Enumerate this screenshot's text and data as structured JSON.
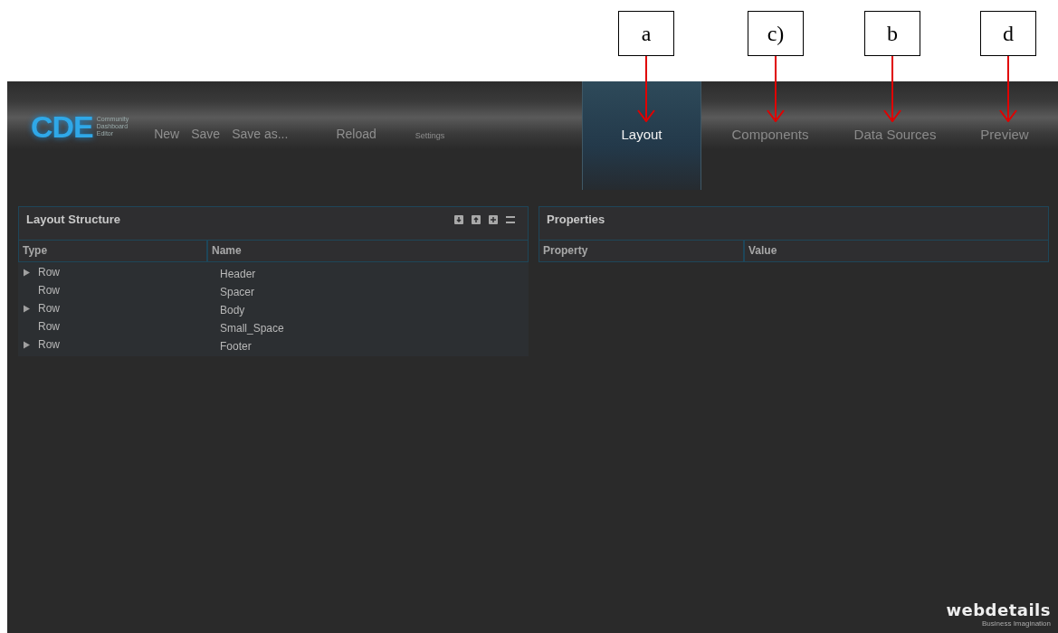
{
  "annotations": [
    {
      "label": "a"
    },
    {
      "label": "c)"
    },
    {
      "label": "b"
    },
    {
      "label": "d"
    }
  ],
  "logo": {
    "mark": "CDE",
    "lines": [
      "Community",
      "Dashboard",
      "Editor"
    ]
  },
  "menu": [
    {
      "label": "New",
      "kind": "main"
    },
    {
      "label": "Save",
      "kind": "main"
    },
    {
      "label": "Save as...",
      "kind": "main"
    },
    {
      "label": "Reload",
      "kind": "main"
    },
    {
      "label": "Settings",
      "kind": "small"
    }
  ],
  "tabs": [
    {
      "label": "Layout",
      "selected": true
    },
    {
      "label": "Components",
      "selected": false
    },
    {
      "label": "Data Sources",
      "selected": false
    },
    {
      "label": "Preview",
      "selected": false
    }
  ],
  "layout_structure": {
    "title": "Layout Structure",
    "columns": [
      "Type",
      "Name"
    ],
    "rows": [
      {
        "type": "Row",
        "name": "Header",
        "expandable": true
      },
      {
        "type": "Row",
        "name": "Spacer",
        "expandable": false
      },
      {
        "type": "Row",
        "name": "Body",
        "expandable": true
      },
      {
        "type": "Row",
        "name": "Small_Space",
        "expandable": false
      },
      {
        "type": "Row",
        "name": "Footer",
        "expandable": true
      }
    ]
  },
  "properties": {
    "title": "Properties",
    "columns": [
      "Property",
      "Value"
    ]
  },
  "footer_logo": {
    "name": "webdetails",
    "tagline": "Business Imagination"
  }
}
